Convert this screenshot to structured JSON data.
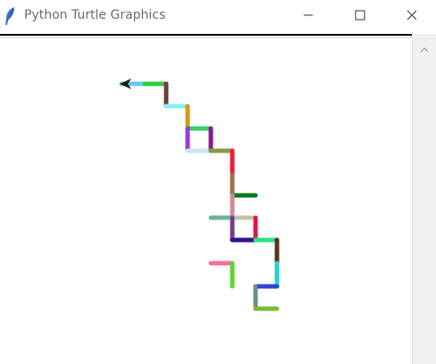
{
  "window": {
    "title": "Python Turtle Graphics",
    "icon": "feather-icon",
    "controls": [
      "minimize-icon",
      "maximize-icon",
      "close-icon"
    ]
  },
  "canvas": {
    "background": "#ffffff",
    "turtle": {
      "icon": "turtle-arrow-icon",
      "color": "#1a1a1a",
      "heading": "left"
    },
    "path_colors": [
      "#67c7f0",
      "#2fce3a",
      "#6a3d3d",
      "#86eff7",
      "#d49a12",
      "#35d163",
      "#9b39d9",
      "#c8e6f7",
      "#8a1a8f",
      "#8c9a46",
      "#ee1f35",
      "#a0724c",
      "#0b7a16",
      "#cf8b98",
      "#c3c4a8",
      "#6ab3a2",
      "#7c3b8a",
      "#2d1290",
      "#e0174e",
      "#2de08a",
      "#5a3418",
      "#27cfd4",
      "#f07098",
      "#5ed42c",
      "#2c46d8",
      "#6b8f82",
      "#7dba38"
    ]
  },
  "scrollbar": {
    "icon": "scroll-up-arrow-icon"
  }
}
